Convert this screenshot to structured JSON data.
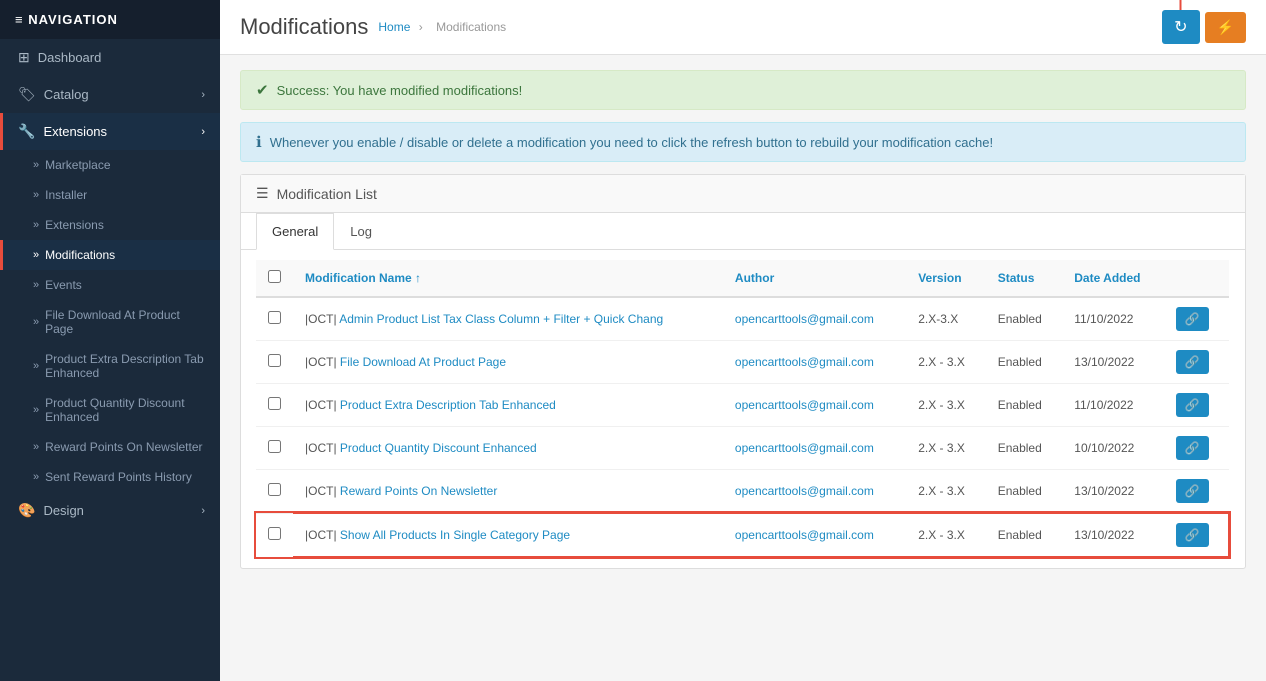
{
  "sidebar": {
    "header": "≡ NAVIGATION",
    "items": [
      {
        "id": "dashboard",
        "label": "Dashboard",
        "icon": "⊞",
        "hasChevron": false,
        "active": false
      },
      {
        "id": "catalog",
        "label": "Catalog",
        "icon": "🏷",
        "hasChevron": true,
        "active": false
      },
      {
        "id": "extensions",
        "label": "Extensions",
        "icon": "🔧",
        "hasChevron": true,
        "active": true,
        "highlighted": true
      },
      {
        "id": "marketplace",
        "label": "Marketplace",
        "sub": true
      },
      {
        "id": "installer",
        "label": "Installer",
        "sub": true
      },
      {
        "id": "extensions-sub",
        "label": "Extensions",
        "sub": true
      },
      {
        "id": "modifications",
        "label": "Modifications",
        "sub": true,
        "activeSub": true
      },
      {
        "id": "events",
        "label": "Events",
        "sub": true
      },
      {
        "id": "file-download",
        "label": "File Download At Product Page",
        "sub": true
      },
      {
        "id": "product-extra",
        "label": "Product Extra Description Tab Enhanced",
        "sub": true
      },
      {
        "id": "product-quantity",
        "label": "Product Quantity Discount Enhanced",
        "sub": true
      },
      {
        "id": "reward-points",
        "label": "Reward Points On Newsletter",
        "sub": true
      },
      {
        "id": "sent-reward",
        "label": "Sent Reward Points History",
        "sub": true
      },
      {
        "id": "design",
        "label": "Design",
        "icon": "🎨",
        "hasChevron": true,
        "active": false
      }
    ]
  },
  "header": {
    "title": "Modifications",
    "breadcrumb_home": "Home",
    "breadcrumb_separator": "›",
    "breadcrumb_current": "Modifications"
  },
  "toolbar": {
    "refresh_label": "↻",
    "extra_label": "⚡"
  },
  "alerts": {
    "success_text": "Success: You have modified modifications!",
    "info_text": "Whenever you enable / disable or delete a modification you need to click the refresh button to rebuild your modification cache!"
  },
  "panel": {
    "heading": "Modification List",
    "tabs": [
      {
        "id": "general",
        "label": "General",
        "active": true
      },
      {
        "id": "log",
        "label": "Log",
        "active": false
      }
    ]
  },
  "table": {
    "columns": [
      {
        "id": "checkbox",
        "label": ""
      },
      {
        "id": "name",
        "label": "Modification Name ↑"
      },
      {
        "id": "author",
        "label": "Author"
      },
      {
        "id": "version",
        "label": "Version"
      },
      {
        "id": "status",
        "label": "Status"
      },
      {
        "id": "date_added",
        "label": "Date Added"
      },
      {
        "id": "action",
        "label": ""
      }
    ],
    "rows": [
      {
        "id": 1,
        "name_prefix": "|OCT|",
        "name_suffix": "Admin Product List Tax Class Column + Filter + Quick Chang",
        "author": "opencarttools@gmail.com",
        "version": "2.X-3.X",
        "status": "Enabled",
        "date_added": "11/10/2022",
        "highlighted": false
      },
      {
        "id": 2,
        "name_prefix": "|OCT|",
        "name_suffix": "File Download At Product Page",
        "author": "opencarttools@gmail.com",
        "version": "2.X - 3.X",
        "status": "Enabled",
        "date_added": "13/10/2022",
        "highlighted": false
      },
      {
        "id": 3,
        "name_prefix": "|OCT|",
        "name_suffix": "Product Extra Description Tab Enhanced",
        "author": "opencarttools@gmail.com",
        "version": "2.X - 3.X",
        "status": "Enabled",
        "date_added": "11/10/2022",
        "highlighted": false
      },
      {
        "id": 4,
        "name_prefix": "|OCT|",
        "name_suffix": "Product Quantity Discount Enhanced",
        "author": "opencarttools@gmail.com",
        "version": "2.X - 3.X",
        "status": "Enabled",
        "date_added": "10/10/2022",
        "highlighted": false
      },
      {
        "id": 5,
        "name_prefix": "|OCT|",
        "name_suffix": "Reward Points On Newsletter",
        "author": "opencarttools@gmail.com",
        "version": "2.X - 3.X",
        "status": "Enabled",
        "date_added": "13/10/2022",
        "highlighted": false
      },
      {
        "id": 6,
        "name_prefix": "|OCT|",
        "name_suffix": "Show All Products In Single Category Page",
        "author": "opencarttools@gmail.com",
        "version": "2.X - 3.X",
        "status": "Enabled",
        "date_added": "13/10/2022",
        "highlighted": true
      }
    ]
  },
  "colors": {
    "sidebar_bg": "#1b2a3b",
    "sidebar_active": "#1e8bc3",
    "teal": "#1e8bc3",
    "orange": "#e67e22",
    "red": "#e74c3c",
    "success_bg": "#dff0d8",
    "info_bg": "#d9edf7"
  }
}
